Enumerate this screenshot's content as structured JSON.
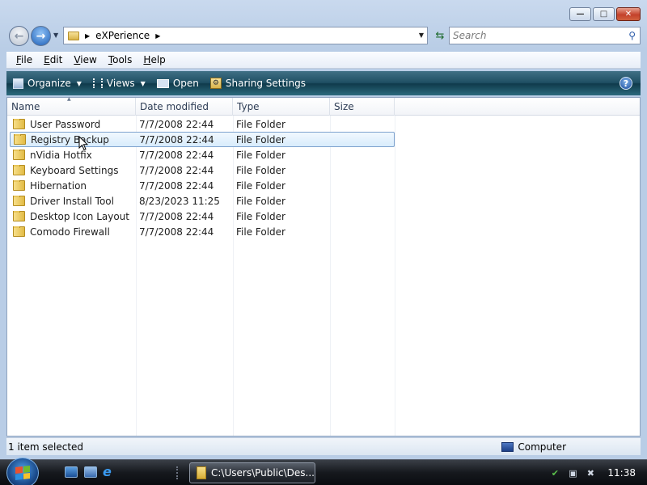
{
  "window": {
    "minimize": "—",
    "maximize": "□",
    "close": "✕"
  },
  "address": {
    "crumbs": [
      "eXPerience"
    ]
  },
  "search": {
    "placeholder": "Search"
  },
  "menu": {
    "items": [
      {
        "first": "F",
        "rest": "ile"
      },
      {
        "first": "E",
        "rest": "dit"
      },
      {
        "first": "V",
        "rest": "iew"
      },
      {
        "first": "T",
        "rest": "ools"
      },
      {
        "first": "H",
        "rest": "elp"
      }
    ]
  },
  "commands": {
    "organize": "Organize",
    "views": "Views",
    "open": "Open",
    "sharing": "Sharing Settings",
    "help": "?"
  },
  "columns": [
    "Name",
    "Date modified",
    "Type",
    "Size"
  ],
  "files": [
    {
      "name": "User Password",
      "date": "7/7/2008 22:44",
      "type": "File Folder",
      "size": ""
    },
    {
      "name": "Registry Backup",
      "date": "7/7/2008 22:44",
      "type": "File Folder",
      "size": "",
      "selected": true
    },
    {
      "name": "nVidia Hotfix",
      "date": "7/7/2008 22:44",
      "type": "File Folder",
      "size": ""
    },
    {
      "name": "Keyboard Settings",
      "date": "7/7/2008 22:44",
      "type": "File Folder",
      "size": ""
    },
    {
      "name": "Hibernation",
      "date": "7/7/2008 22:44",
      "type": "File Folder",
      "size": ""
    },
    {
      "name": "Driver Install Tool",
      "date": "8/23/2023 11:25",
      "type": "File Folder",
      "size": ""
    },
    {
      "name": "Desktop Icon Layout",
      "date": "7/7/2008 22:44",
      "type": "File Folder",
      "size": ""
    },
    {
      "name": "Comodo Firewall",
      "date": "7/7/2008 22:44",
      "type": "File Folder",
      "size": ""
    }
  ],
  "status": {
    "selection": "1 item selected",
    "location": "Computer"
  },
  "taskbar": {
    "window_label": "C:\\Users\\Public\\Des...",
    "clock": "11:38"
  },
  "colors": {
    "selection_border": "#7da2ce",
    "command_bar": "#1f4f63"
  }
}
